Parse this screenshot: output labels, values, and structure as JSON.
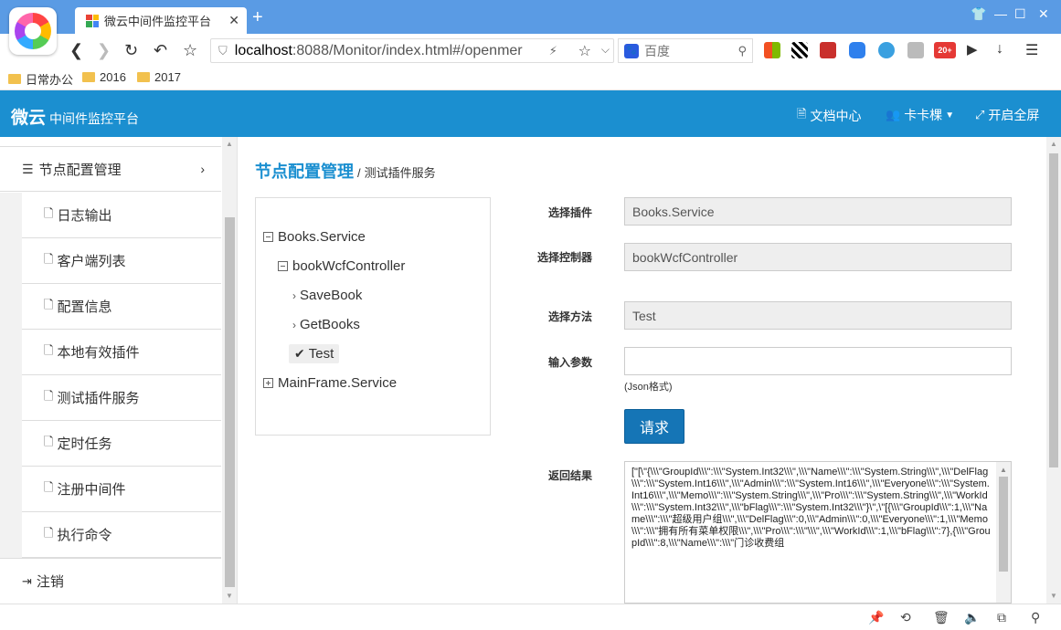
{
  "browser": {
    "tab_title": "微云中间件监控平台",
    "tab_close": "✕",
    "new_tab": "+",
    "url_host": "localhost",
    "url_path": ":8088/Monitor/index.html#/openmer",
    "search_placeholder": "百度",
    "bookmarks": [
      "日常办公",
      "2016",
      "2017"
    ]
  },
  "nav": {
    "brand": "微云",
    "brand_sub": "中间件监控平台",
    "docs": "文档中心",
    "user": "卡卡棵",
    "fullscreen": "开启全屏"
  },
  "sidebar": {
    "header": "节点配置管理",
    "items": [
      "日志输出",
      "客户端列表",
      "配置信息",
      "本地有效插件",
      "测试插件服务",
      "定时任务",
      "注册中间件",
      "执行命令"
    ],
    "logout": "注销"
  },
  "breadcrumb": {
    "title": "节点配置管理",
    "separator": "/",
    "sub": "测试插件服务"
  },
  "tree": {
    "root1": "Books.Service",
    "controller": "bookWcfController",
    "methods": [
      "SaveBook",
      "GetBooks",
      "Test"
    ],
    "root2": "MainFrame.Service"
  },
  "form": {
    "plugin_label": "选择插件",
    "plugin_value": "Books.Service",
    "controller_label": "选择控制器",
    "controller_value": "bookWcfController",
    "method_label": "选择方法",
    "method_value": "Test",
    "params_label": "输入参数",
    "params_value": "",
    "params_hint": "(Json格式)",
    "submit": "请求",
    "result_label": "返回结果",
    "result_text": "[\"[\\\"{\\\\\\\"GroupId\\\\\\\":\\\\\\\"System.Int32\\\\\\\",\\\\\\\"Name\\\\\\\":\\\\\\\"System.String\\\\\\\",\\\\\\\"DelFlag\\\\\\\":\\\\\\\"System.Int16\\\\\\\",\\\\\\\"Admin\\\\\\\":\\\\\\\"System.Int16\\\\\\\",\\\\\\\"Everyone\\\\\\\":\\\\\\\"System.Int16\\\\\\\",\\\\\\\"Memo\\\\\\\":\\\\\\\"System.String\\\\\\\",\\\\\\\"Pro\\\\\\\":\\\\\\\"System.String\\\\\\\",\\\\\\\"WorkId\\\\\\\":\\\\\\\"System.Int32\\\\\\\",\\\\\\\"bFlag\\\\\\\":\\\\\\\"System.Int32\\\\\\\"}\\\",\\\"[{\\\\\\\"GroupId\\\\\\\":1,\\\\\\\"Name\\\\\\\":\\\\\\\"超级用户组\\\\\\\",\\\\\\\"DelFlag\\\\\\\":0,\\\\\\\"Admin\\\\\\\":0,\\\\\\\"Everyone\\\\\\\":1,\\\\\\\"Memo\\\\\\\":\\\\\\\"拥有所有菜单权限\\\\\\\",\\\\\\\"Pro\\\\\\\":\\\\\\\"\\\\\\\",\\\\\\\"WorkId\\\\\\\":1,\\\\\\\"bFlag\\\\\\\":7},{\\\\\\\"GroupId\\\\\\\":8,\\\\\\\"Name\\\\\\\":\\\\\\\"门诊收费组"
  },
  "colors": {
    "titlebar": "#5a9be4",
    "appnav": "#1b8fd0",
    "button": "#1575b6"
  }
}
